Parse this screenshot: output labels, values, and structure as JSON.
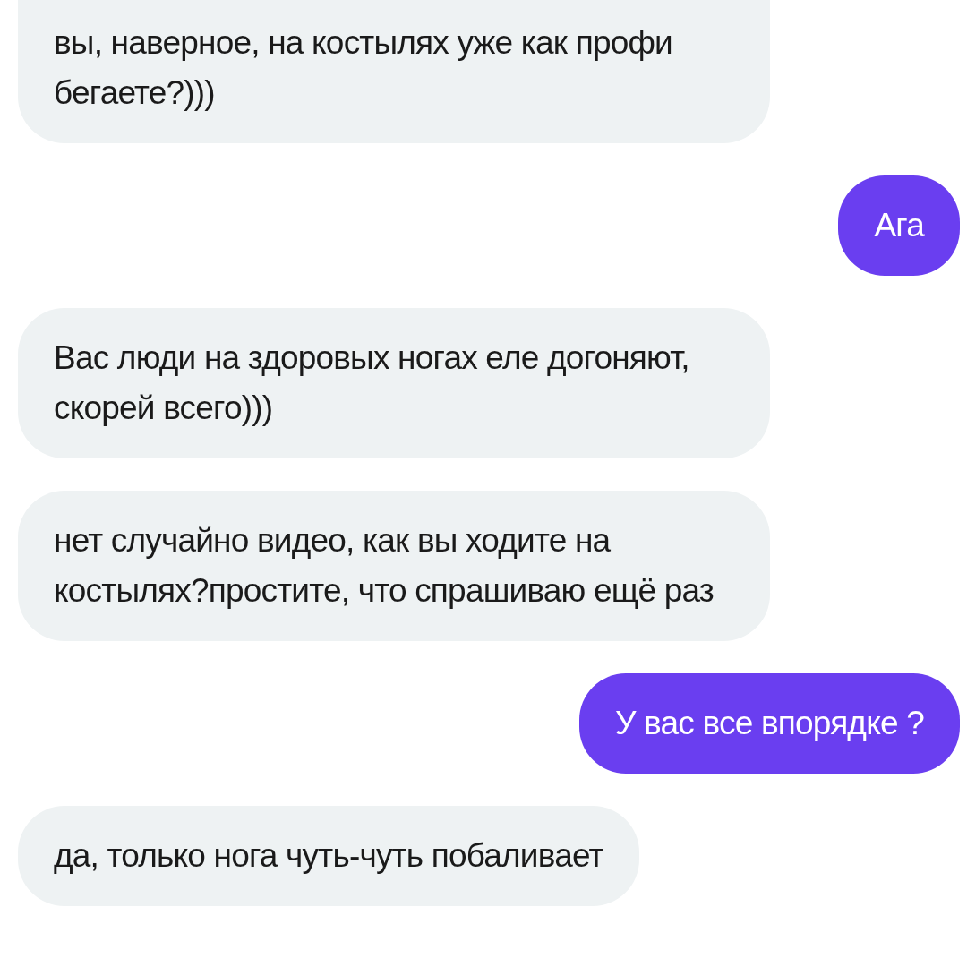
{
  "messages": [
    {
      "kind": "incoming",
      "text": "вы, наверное, на костылях уже как профи бегаете?)))"
    },
    {
      "kind": "outgoing",
      "text": "Ага"
    },
    {
      "kind": "incoming",
      "text": "Вас люди на здоровых ногах еле догоняют, скорей всего)))"
    },
    {
      "kind": "incoming",
      "text": "нет случайно видео, как вы ходите на костылях?простите, что спрашиваю ещё раз"
    },
    {
      "kind": "outgoing",
      "text": "У вас все впорядке ?"
    },
    {
      "kind": "incoming",
      "text": "да, только нога чуть-чуть побаливает"
    }
  ]
}
